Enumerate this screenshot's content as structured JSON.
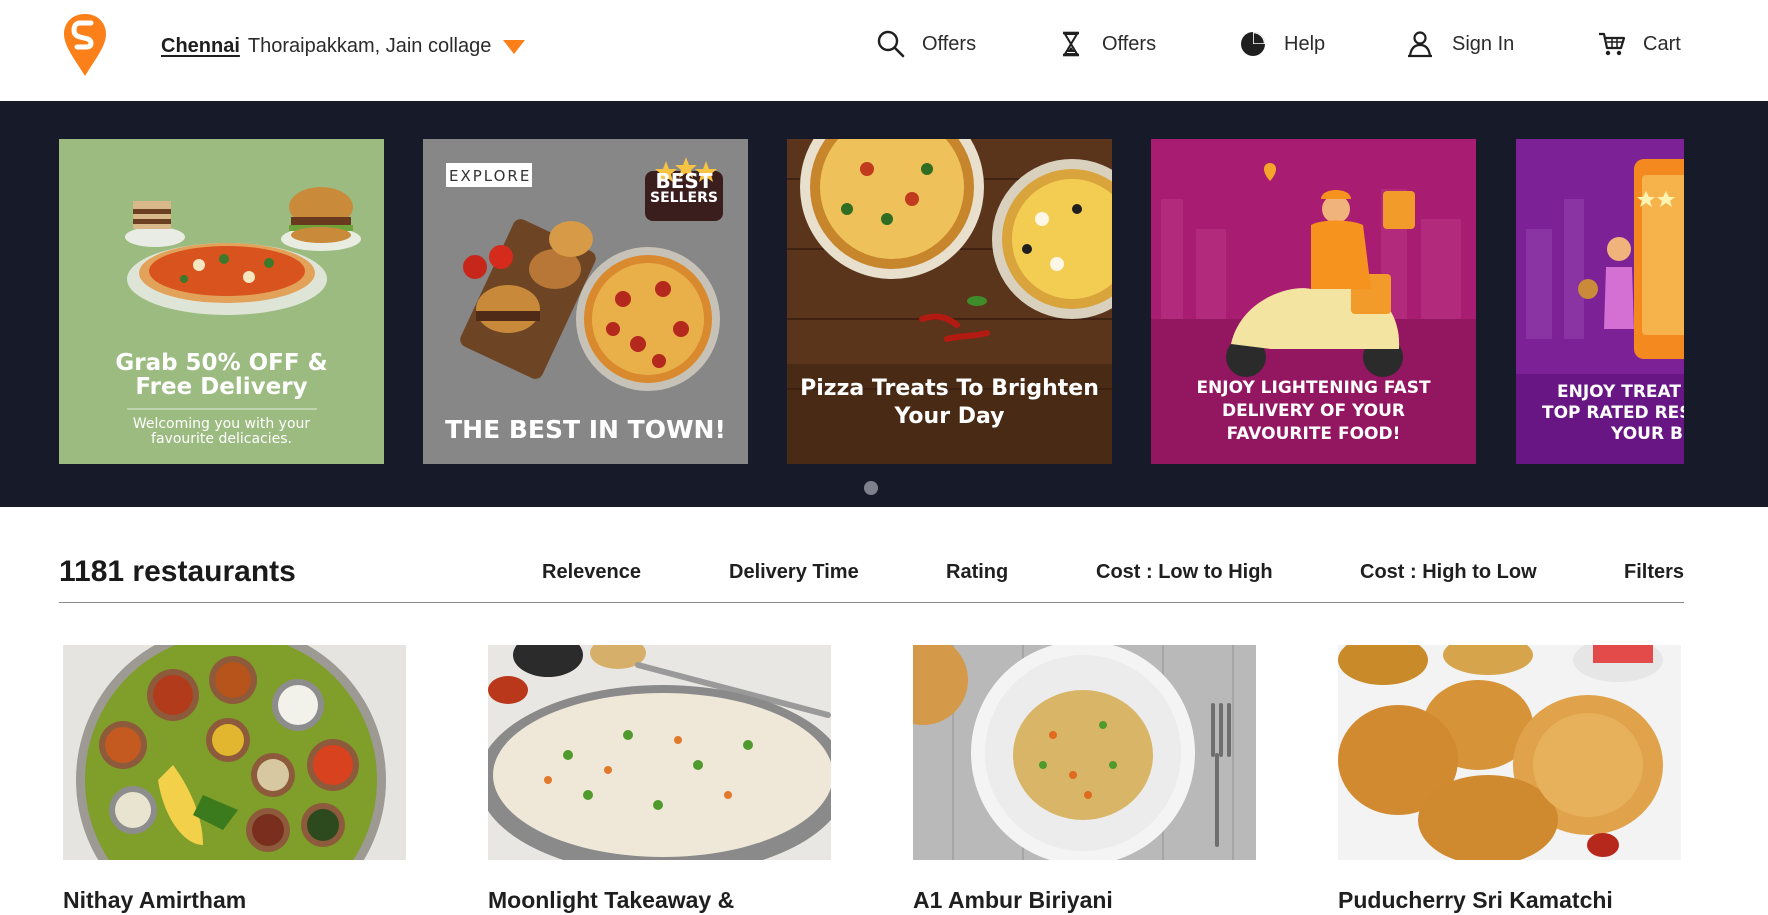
{
  "header": {
    "logo_alt": "Swiggy",
    "location": {
      "city": "Chennai",
      "area": "Thoraipakkam, Jain collage"
    },
    "nav": [
      {
        "icon": "search-icon",
        "label": "Offers"
      },
      {
        "icon": "hourglass-icon",
        "label": "Offers"
      },
      {
        "icon": "pie-chart-icon",
        "label": "Help"
      },
      {
        "icon": "user-icon",
        "label": "Sign In"
      },
      {
        "icon": "cart-icon",
        "label": "Cart"
      }
    ]
  },
  "carousel": {
    "banners": [
      {
        "line1": "Grab 50% OFF &",
        "line2": "Free Delivery",
        "sub1": "Welcoming you with your",
        "sub2": "favourite delicacies."
      },
      {
        "badge": "EXPLORE",
        "best1": "BEST",
        "best2": "SELLERS",
        "caption": "THE BEST IN TOWN!"
      },
      {
        "line1": "Pizza Treats To Brighten",
        "line2": "Your Day"
      },
      {
        "line1": "ENJOY LIGHTENING FAST",
        "line2": "DELIVERY OF YOUR",
        "line3": "FAVOURITE FOOD!"
      },
      {
        "line1": "ENJOY TREAT",
        "line2": "TOP RATED RES",
        "line3": "YOUR B"
      }
    ]
  },
  "listing": {
    "count": "1181 restaurants",
    "sort_options": [
      "Relevence",
      "Delivery Time",
      "Rating",
      "Cost : Low to High",
      "Cost : High to Low",
      "Filters"
    ]
  },
  "restaurants": [
    {
      "name": "Nithay Amirtham"
    },
    {
      "name": "Moonlight Takeaway &"
    },
    {
      "name": "A1 Ambur Biriyani"
    },
    {
      "name": "Puducherry Sri Kamatchi"
    }
  ],
  "colors": {
    "brand": "#fc8019",
    "carousel_bg": "#171a29",
    "text": "#1f1f1f"
  }
}
